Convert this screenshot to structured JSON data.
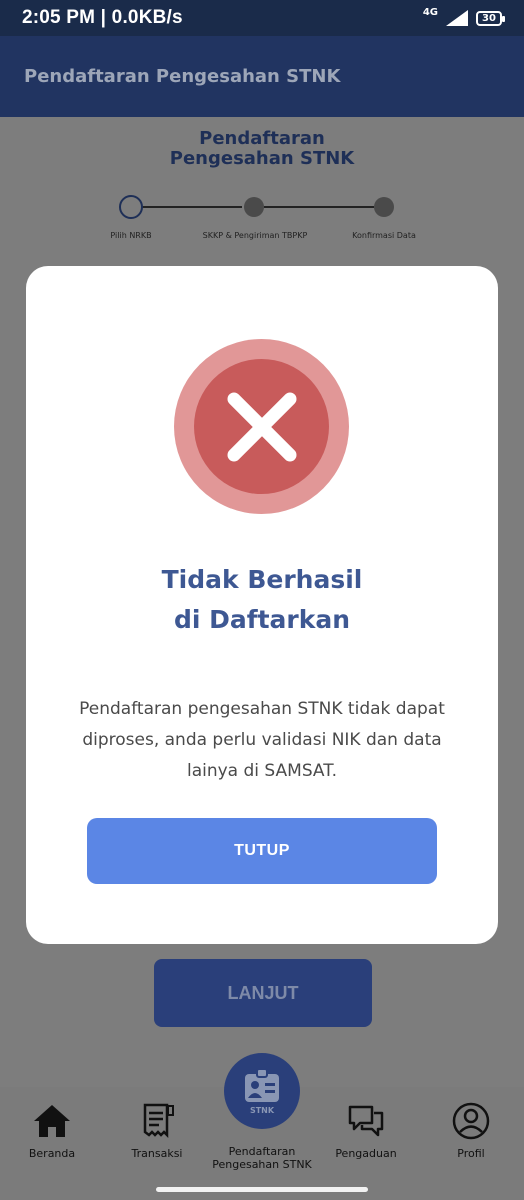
{
  "status_bar": {
    "time": "2:05 PM | 0.0KB/s",
    "network": "4G",
    "battery": "30"
  },
  "app_bar": {
    "title": "Pendaftaran Pengesahan STNK"
  },
  "page": {
    "heading": [
      "Pendaftaran",
      "Pengesahan STNK"
    ],
    "steps": [
      {
        "label": "Pilih NRKB",
        "state": "current"
      },
      {
        "label": "SKKP & Pengiriman TBPKP",
        "state": "pending"
      },
      {
        "label": "Konfirmasi Data",
        "state": "pending"
      }
    ],
    "next_button": "LANJUT"
  },
  "modal": {
    "icon": "error-x-icon",
    "title_line1": "Tidak Berhasil",
    "title_line2": "di Daftarkan",
    "message": "Pendaftaran pengesahan STNK tidak dapat diproses, anda perlu validasi NIK dan data lainya di SAMSAT.",
    "close_button": "TUTUP"
  },
  "bottom_nav": {
    "items": [
      {
        "label": "Beranda",
        "icon": "home-icon"
      },
      {
        "label": "Transaksi",
        "icon": "receipt-icon"
      },
      {
        "label": "Pendaftaran Pengesahan STNK",
        "icon": "id-badge-icon",
        "badge_text": "STNK"
      },
      {
        "label": "Pengaduan",
        "icon": "chat-icon"
      },
      {
        "label": "Profil",
        "icon": "user-icon"
      }
    ]
  },
  "colors": {
    "primary": "#213461",
    "accent_button": "#5b86e5",
    "error_red": "#c85b5b",
    "error_ring": "#e19797",
    "title_blue": "#3e5893",
    "overlay": "#7d7d7d"
  }
}
